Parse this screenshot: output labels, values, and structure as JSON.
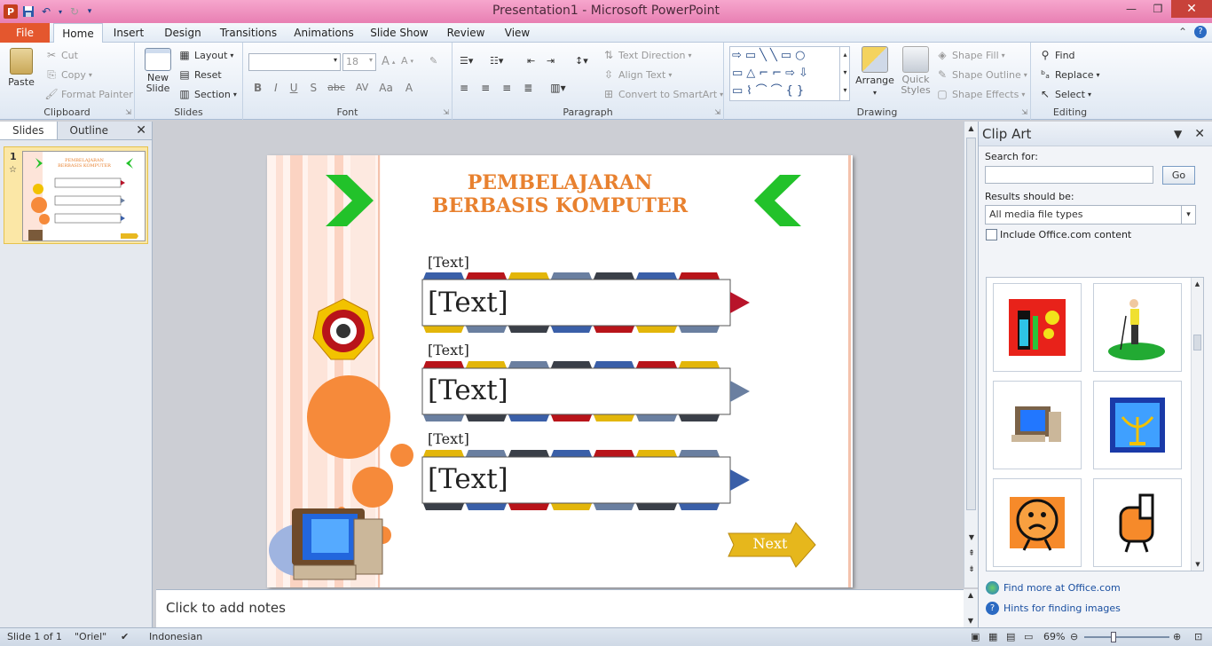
{
  "window": {
    "title": "Presentation1 - Microsoft PowerPoint"
  },
  "tabs": {
    "file": "File",
    "home": "Home",
    "insert": "Insert",
    "design": "Design",
    "transitions": "Transitions",
    "animations": "Animations",
    "slideshow": "Slide Show",
    "review": "Review",
    "view": "View"
  },
  "ribbon": {
    "clipboard": {
      "label": "Clipboard",
      "paste": "Paste",
      "cut": "Cut",
      "copy": "Copy",
      "format_painter": "Format Painter"
    },
    "slides": {
      "label": "Slides",
      "new_slide": "New Slide",
      "layout": "Layout",
      "reset": "Reset",
      "section": "Section"
    },
    "font": {
      "label": "Font",
      "size": "18"
    },
    "paragraph": {
      "label": "Paragraph",
      "text_direction": "Text Direction",
      "align_text": "Align Text",
      "convert_smartart": "Convert to SmartArt"
    },
    "drawing": {
      "label": "Drawing",
      "arrange": "Arrange",
      "quick_styles": "Quick Styles",
      "shape_fill": "Shape Fill",
      "shape_outline": "Shape Outline",
      "shape_effects": "Shape Effects"
    },
    "editing": {
      "label": "Editing",
      "find": "Find",
      "replace": "Replace",
      "select": "Select"
    }
  },
  "panel": {
    "tab_slides": "Slides",
    "tab_outline": "Outline",
    "slide_number": "1"
  },
  "slide": {
    "title_line1": "PEMBELAJARAN",
    "title_line2": "BERBASIS KOMPUTER",
    "items": [
      {
        "label": "[Text]",
        "box": "[Text]"
      },
      {
        "label": "[Text]",
        "box": "[Text]"
      },
      {
        "label": "[Text]",
        "box": "[Text]"
      }
    ],
    "next": "Next",
    "colors": {
      "title": "#e8812f",
      "chevron": "#22c22a",
      "circle": "#f68a3a",
      "arrow_red": "#b8142a",
      "arrow_blue": "#3a5fa8",
      "arrow_gray": "#6a7fa0"
    }
  },
  "notes": {
    "placeholder": "Click to add notes"
  },
  "clipart": {
    "title": "Clip Art",
    "search_label": "Search for:",
    "search_value": "",
    "go": "Go",
    "results_label": "Results should be:",
    "results_value": "All media file types",
    "include_office": "Include Office.com content",
    "find_more": "Find more at Office.com",
    "hints": "Hints for finding images"
  },
  "status": {
    "slide_info": "Slide 1 of 1",
    "theme": "\"Oriel\"",
    "language": "Indonesian",
    "zoom": "69%"
  }
}
